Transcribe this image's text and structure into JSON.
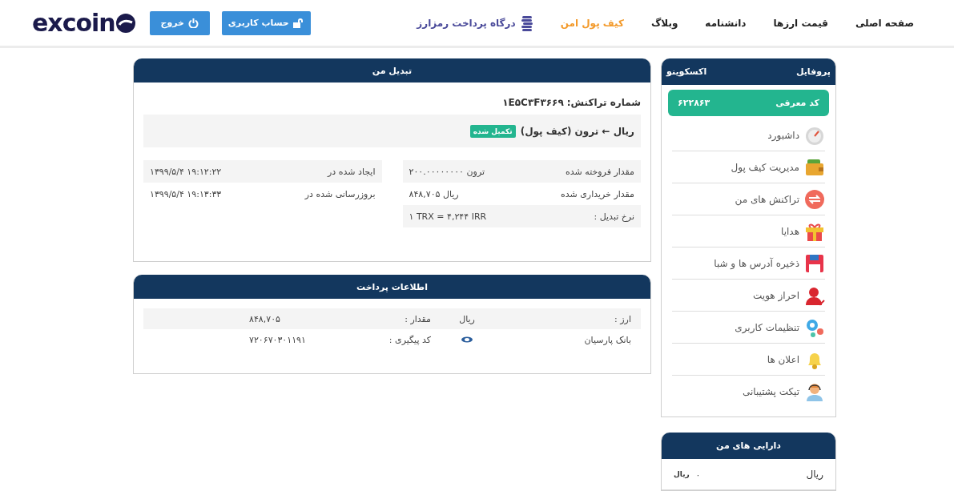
{
  "header": {
    "logo": "excoin",
    "nav": [
      {
        "label": "صفحه اصلی",
        "selected": false,
        "kind": "link"
      },
      {
        "label": "قیمت ارزها",
        "selected": false,
        "kind": "link"
      },
      {
        "label": "دانشنامه",
        "selected": false,
        "kind": "link"
      },
      {
        "label": "وبلاگ",
        "selected": false,
        "kind": "link"
      },
      {
        "label": "کیف پول امن",
        "selected": true,
        "kind": "link"
      },
      {
        "label": "درگاه پرداخت رمزارز",
        "selected": false,
        "kind": "gateway"
      }
    ],
    "buttons": [
      {
        "label": "حساب کاربری",
        "kind": "account"
      },
      {
        "label": "خروج",
        "kind": "logout"
      }
    ]
  },
  "sidebar": {
    "title": "پروفایل",
    "username": "اکسکوینو",
    "referral": {
      "label": "کد معرفی",
      "code": "۶۲۲۸۶۳"
    },
    "items": [
      {
        "label": "داشبورد"
      },
      {
        "label": "مدیریت کیف پول"
      },
      {
        "label": "تراکنش های من"
      },
      {
        "label": "هدایا"
      },
      {
        "label": "ذخیره آدرس ها و شبا"
      },
      {
        "label": "احراز هویت"
      },
      {
        "label": "تنظیمات کاربری"
      },
      {
        "label": "اعلان ها"
      },
      {
        "label": "تیکت پشتیبانی"
      }
    ]
  },
  "assets": {
    "title": "دارایی های من",
    "rows": [
      {
        "name": "ریال",
        "amount": "۰",
        "unit": "ریال"
      }
    ]
  },
  "exchange": {
    "title": "تبدیل من",
    "transaction_label": "شماره تراکنش:",
    "transaction_id": "۱E۵C۳F۳۶۶۹",
    "pair": "ریال ← ترون (کیف پول)",
    "status": "تکمیل شده",
    "details_right": [
      {
        "label": "مقدار فروخته شده",
        "value": "ترون ۲۰۰.۰۰۰۰۰۰۰۰"
      },
      {
        "label": "مقدار خریداری شده",
        "value": "ریال ۸۴۸,۷۰۵"
      },
      {
        "label": "نرخ تبدیل :",
        "value": "۱ TRX = ۴,۲۴۴ IRR"
      }
    ],
    "details_left": [
      {
        "label": "ایجاد شده در",
        "value": "۱۳۹۹/۵/۴ ۱۹:۱۲:۲۲"
      },
      {
        "label": "بروزرسانی شده در",
        "value": "۱۳۹۹/۵/۴ ۱۹:۱۳:۳۳"
      }
    ]
  },
  "payment": {
    "title": "اطلاعات پرداخت",
    "rows": [
      {
        "label": "ارز :",
        "value": "ریال",
        "label_2": "مقدار :",
        "value_2": "۸۴۸,۷۰۵"
      },
      {
        "label": "بانک پارسیان",
        "kind": "bank",
        "label_2": "کد پیگیری :",
        "value_2": "۷۲۰۶۷۰۳۰۱۱۹۱"
      }
    ]
  }
}
